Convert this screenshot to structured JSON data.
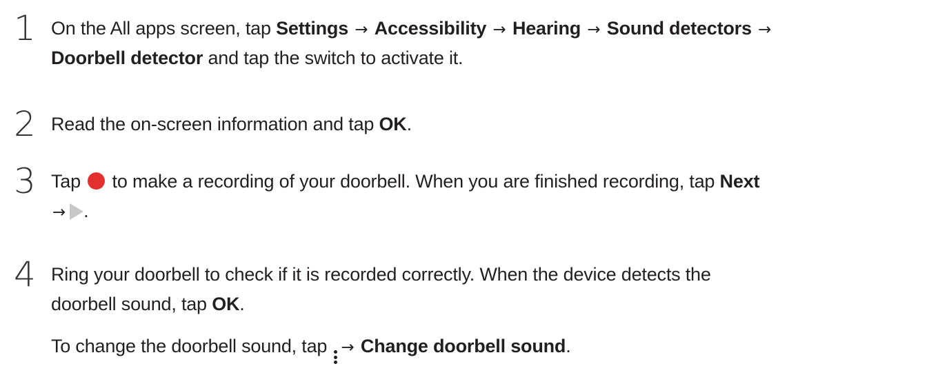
{
  "steps": [
    {
      "number": "1",
      "line1": {
        "a": "On the All apps screen, tap ",
        "b1": "Settings",
        "arrow1": "→",
        "b2": "Accessibility",
        "arrow2": "→",
        "b3": "Hearing",
        "arrow3": "→",
        "b4": "Sound detectors",
        "arrow4": "→"
      },
      "line2": {
        "b1": "Doorbell detector",
        "a": " and tap the switch to activate it."
      }
    },
    {
      "number": "2",
      "line1": {
        "a": "Read the on-screen information and tap ",
        "b1": "OK",
        "end": "."
      }
    },
    {
      "number": "3",
      "line1": {
        "a": "Tap ",
        "icon": "record-icon",
        "b": " to make a recording of your doorbell. When you are finished recording, tap ",
        "b1": "Next"
      },
      "line2": {
        "arrow": "→",
        "icon": "play-icon",
        "end": "."
      }
    },
    {
      "number": "4",
      "line1": {
        "a": "Ring your doorbell to check if it is recorded correctly. When the device detects the"
      },
      "line2": {
        "a": "doorbell sound, tap ",
        "b1": "OK",
        "end": "."
      },
      "line3": {
        "a": "To change the doorbell sound, tap ",
        "icon": "more-options-icon",
        "arrow": "→",
        "b1": "Change doorbell sound",
        "end": "."
      }
    }
  ],
  "colors": {
    "text": "#231f20",
    "record": "#e3302f",
    "play": "#c7c7c7"
  }
}
